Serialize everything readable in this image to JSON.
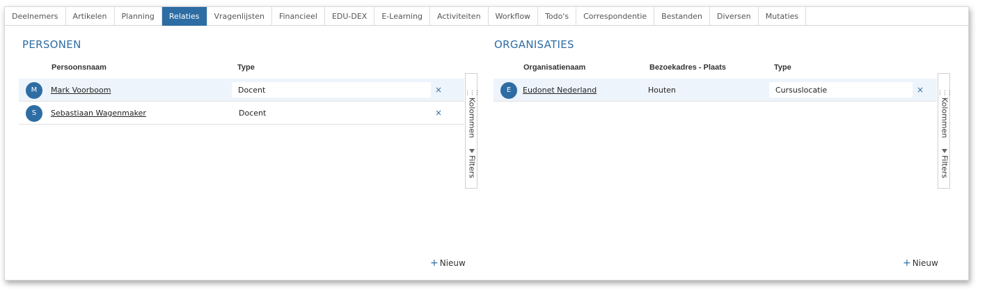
{
  "tabs": [
    {
      "label": "Deelnemers",
      "active": false
    },
    {
      "label": "Artikelen",
      "active": false
    },
    {
      "label": "Planning",
      "active": false
    },
    {
      "label": "Relaties",
      "active": true
    },
    {
      "label": "Vragenlijsten",
      "active": false
    },
    {
      "label": "Financieel",
      "active": false
    },
    {
      "label": "EDU-DEX",
      "active": false
    },
    {
      "label": "E-Learning",
      "active": false
    },
    {
      "label": "Activiteiten",
      "active": false
    },
    {
      "label": "Workflow",
      "active": false
    },
    {
      "label": "Todo's",
      "active": false
    },
    {
      "label": "Correspondentie",
      "active": false
    },
    {
      "label": "Bestanden",
      "active": false
    },
    {
      "label": "Diversen",
      "active": false
    },
    {
      "label": "Mutaties",
      "active": false
    }
  ],
  "personen": {
    "title": "PERSONEN",
    "columns": {
      "name": "Persoonsnaam",
      "type": "Type"
    },
    "rows": [
      {
        "initial": "M",
        "name": "Mark Voorboom",
        "type": "Docent",
        "remove": "×"
      },
      {
        "initial": "S",
        "name": "Sebastiaan Wagenmaker",
        "type": "Docent",
        "remove": "×"
      }
    ],
    "sidebar": {
      "columns_label": "Kolommen",
      "filters_label": "Filters"
    },
    "new_label": "Nieuw"
  },
  "organisaties": {
    "title": "ORGANISATIES",
    "columns": {
      "name": "Organisatienaam",
      "address": "Bezoekadres - Plaats",
      "type": "Type"
    },
    "rows": [
      {
        "initial": "E",
        "name": "Eudonet Nederland",
        "place": "Houten",
        "type": "Cursuslocatie",
        "remove": "×"
      }
    ],
    "sidebar": {
      "columns_label": "Kolommen",
      "filters_label": "Filters"
    },
    "new_label": "Nieuw"
  },
  "colors": {
    "accent": "#2e6da4",
    "selected_row": "#eef4fb"
  },
  "icons": {
    "grid": "grid-icon",
    "filter": "filter-icon",
    "plus": "plus-icon",
    "remove": "close-icon"
  }
}
